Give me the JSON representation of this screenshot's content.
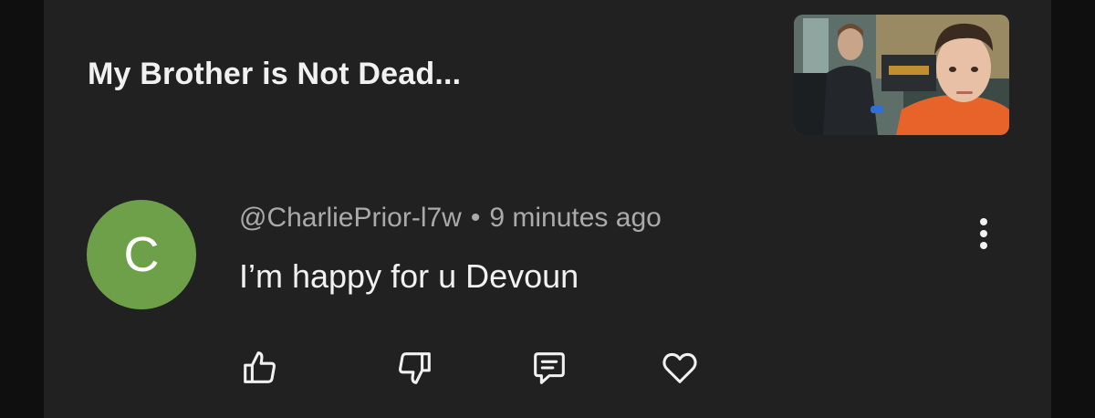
{
  "video": {
    "title": "My Brother is Not Dead..."
  },
  "comment": {
    "avatar_letter": "C",
    "avatar_color": "#6ea04a",
    "author": "@CharliePrior-l7w",
    "separator": "•",
    "time": "9 minutes ago",
    "text": "I’m happy for u Devoun"
  },
  "actions": [
    {
      "icon": "thumbs-up-icon"
    },
    {
      "icon": "thumbs-down-icon"
    },
    {
      "icon": "reply-comment-icon"
    },
    {
      "icon": "heart-icon"
    }
  ],
  "colors": {
    "background": "#0f0f0f",
    "card": "#212121",
    "primary_text": "#f1f1f1",
    "secondary_text": "#aaaaaa"
  }
}
